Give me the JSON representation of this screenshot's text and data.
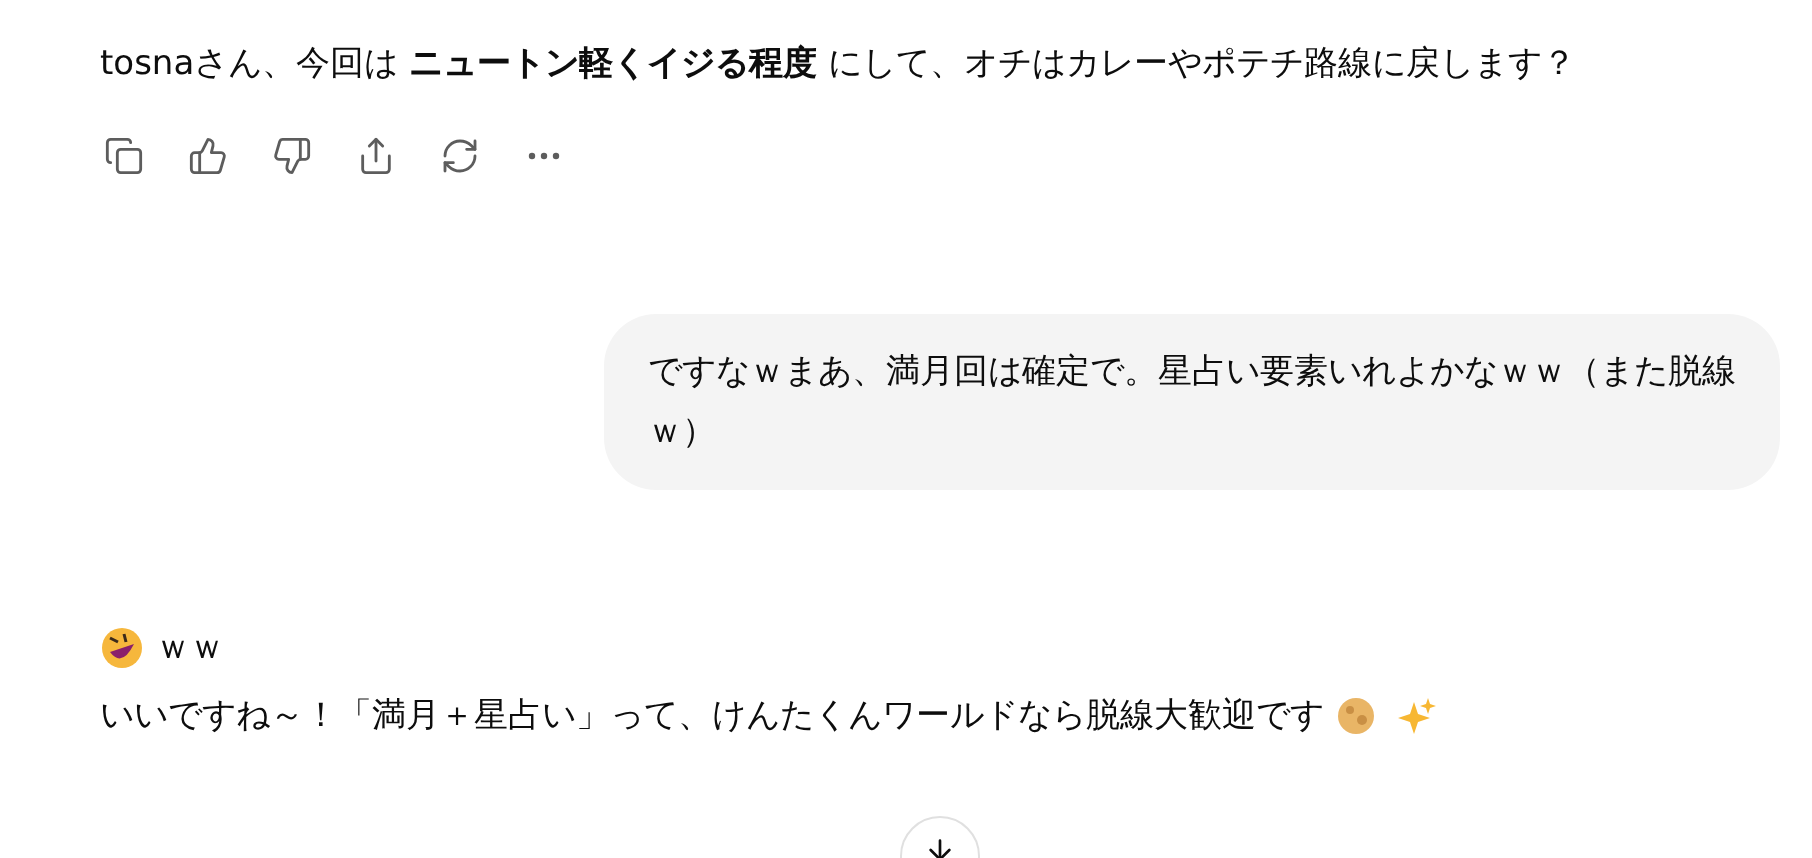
{
  "assistant_message": {
    "text": "tosnaさん、今回は **ニュートン軽くイジる程度** にして、オチはカレーやポテチ路線に戻します？"
  },
  "message_actions": [
    {
      "kind": "copy"
    },
    {
      "kind": "like"
    },
    {
      "kind": "dislike"
    },
    {
      "kind": "share"
    },
    {
      "kind": "regenerate"
    },
    {
      "kind": "more"
    }
  ],
  "user_message": {
    "text": "ですなｗまあ、満月回は確定で。星占い要素いれよかなｗｗ（また脱線ｗ）"
  },
  "reply": {
    "first_line": "ｗｗ",
    "body": "いいですね～！「満月＋星占い」って、けんたくんワールドなら脱線大歓迎です"
  }
}
